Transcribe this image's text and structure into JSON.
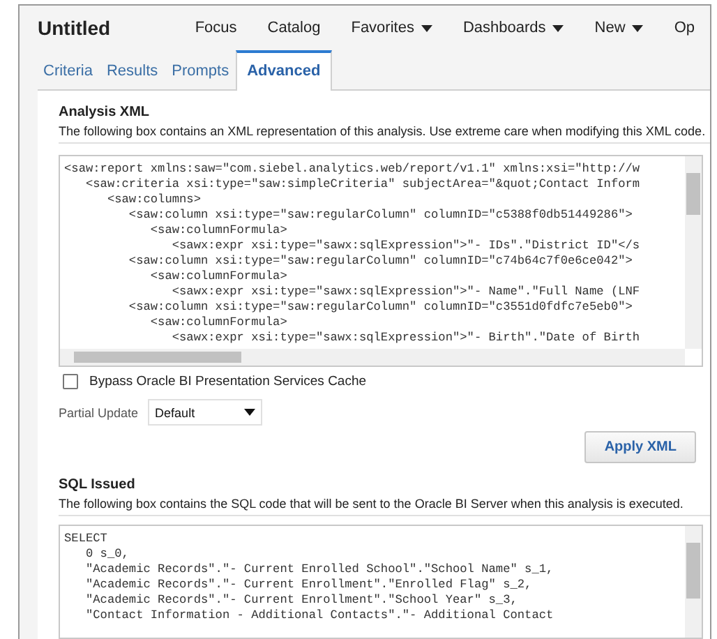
{
  "header": {
    "title": "Untitled",
    "menu": [
      {
        "label": "Focus",
        "dropdown": false
      },
      {
        "label": "Catalog",
        "dropdown": false
      },
      {
        "label": "Favorites",
        "dropdown": true
      },
      {
        "label": "Dashboards",
        "dropdown": true
      },
      {
        "label": "New",
        "dropdown": true
      },
      {
        "label": "Op",
        "dropdown": false
      }
    ]
  },
  "tabs": [
    {
      "label": "Criteria",
      "selected": false
    },
    {
      "label": "Results",
      "selected": false
    },
    {
      "label": "Prompts",
      "selected": false
    },
    {
      "label": "Advanced",
      "selected": true
    }
  ],
  "analysis_xml": {
    "heading": "Analysis XML",
    "description": "The following box contains an XML representation of this analysis. Use extreme care when modifying this XML code.",
    "lines": [
      "<saw:report xmlns:saw=\"com.siebel.analytics.web/report/v1.1\" xmlns:xsi=\"http://w",
      "   <saw:criteria xsi:type=\"saw:simpleCriteria\" subjectArea=\"&quot;Contact Inform",
      "      <saw:columns>",
      "         <saw:column xsi:type=\"saw:regularColumn\" columnID=\"c5388f0db51449286\">",
      "            <saw:columnFormula>",
      "               <sawx:expr xsi:type=\"sawx:sqlExpression\">\"- IDs\".\"District ID\"</s",
      "         <saw:column xsi:type=\"saw:regularColumn\" columnID=\"c74b64c7f0e6ce042\">",
      "            <saw:columnFormula>",
      "               <sawx:expr xsi:type=\"sawx:sqlExpression\">\"- Name\".\"Full Name (LNF",
      "         <saw:column xsi:type=\"saw:regularColumn\" columnID=\"c3551d0fdfc7e5eb0\">",
      "            <saw:columnFormula>",
      "               <sawx:expr xsi:type=\"sawx:sqlExpression\">\"- Birth\".\"Date of Birth"
    ]
  },
  "bypass_cache": {
    "label": "Bypass Oracle BI Presentation Services Cache",
    "checked": false
  },
  "partial_update": {
    "label": "Partial Update",
    "value": "Default"
  },
  "apply_button": "Apply XML",
  "sql_issued": {
    "heading": "SQL Issued",
    "description": "The following box contains the SQL code that will be sent to the Oracle BI Server when this analysis is executed.",
    "lines": [
      "SELECT",
      "   0 s_0,",
      "   \"Academic Records\".\"- Current Enrolled School\".\"School Name\" s_1,",
      "   \"Academic Records\".\"- Current Enrollment\".\"Enrolled Flag\" s_2,",
      "   \"Academic Records\".\"- Current Enrollment\".\"School Year\" s_3,",
      "   \"Contact Information - Additional Contacts\".\"- Additional Contact"
    ]
  }
}
